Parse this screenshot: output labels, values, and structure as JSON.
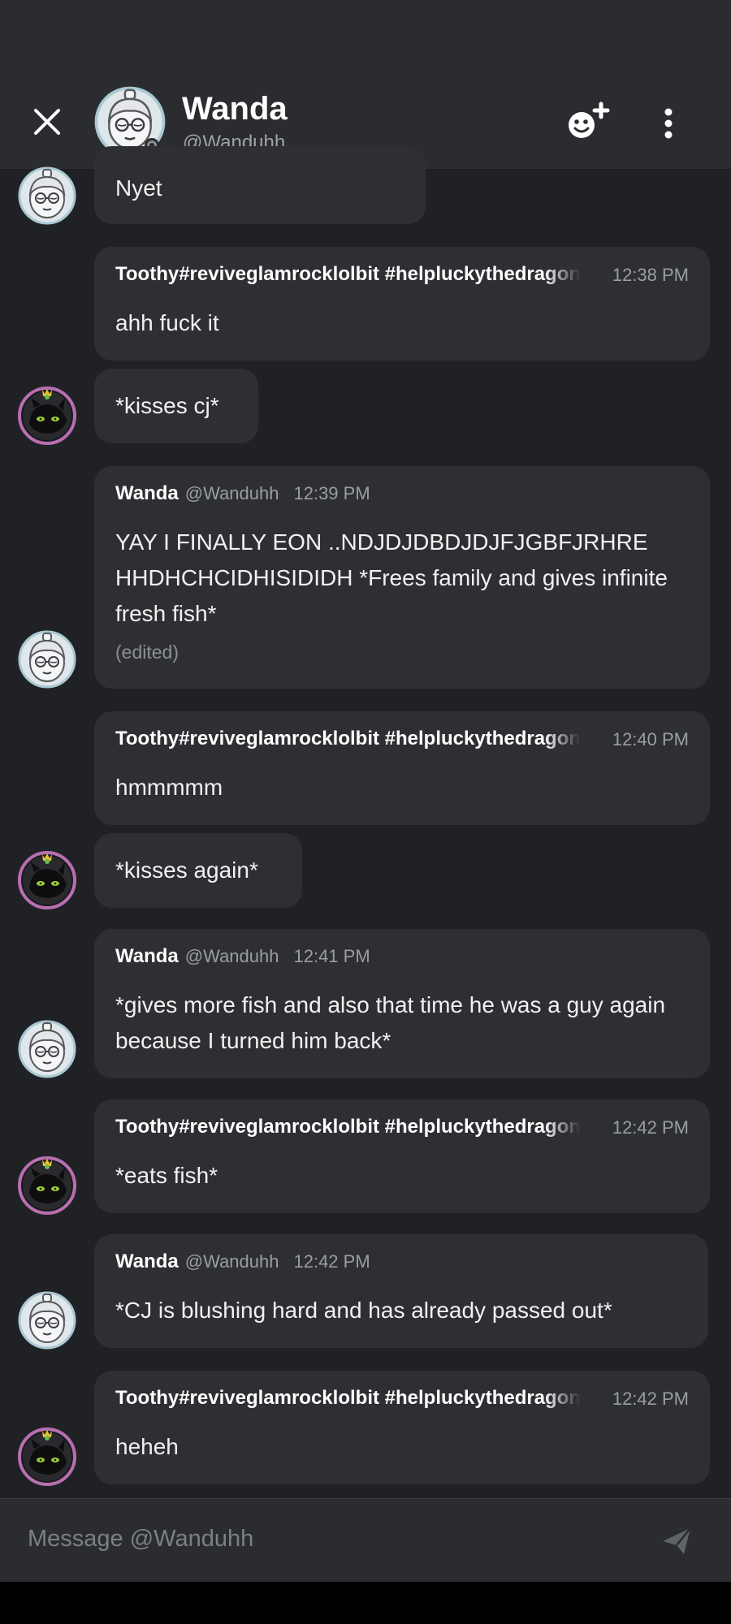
{
  "header": {
    "name": "Wanda",
    "handle": "@Wanduhh"
  },
  "messages": [
    {
      "avatar": "wanda",
      "text": "Nyet"
    },
    {
      "author": "Toothy#reviveglamrocklolbit #helpluckythedragon",
      "time": "12:38 PM",
      "text": "ahh fuck it"
    },
    {
      "avatar": "toothy",
      "text": "*kisses cj*"
    },
    {
      "author": "Wanda",
      "handle": "@Wanduhh",
      "time": "12:39 PM",
      "text": "YAY I FINALLY EON ..NDJDJDBDJDJFJGBFJRHRE HHDHCHCIDHISIDIDH *Frees family and gives infinite fresh fish*",
      "edited": "(edited)"
    },
    {
      "author": "Toothy#reviveglamrocklolbit #helpluckythedragon",
      "time": "12:40 PM",
      "text": "hmmmmm"
    },
    {
      "avatar": "toothy",
      "text": "*kisses again*"
    },
    {
      "author": "Wanda",
      "handle": "@Wanduhh",
      "time": "12:41 PM",
      "text": "*gives more fish and also that time he was a guy again because I turned him back*"
    },
    {
      "author": "Toothy#reviveglamrocklolbit #helpluckythedragon",
      "time": "12:42 PM",
      "text": "*eats fish*"
    },
    {
      "author": "Wanda",
      "handle": "@Wanduhh",
      "time": "12:42 PM",
      "text": "*CJ is blushing hard and has already passed out*"
    },
    {
      "author": "Toothy#reviveglamrocklolbit #helpluckythedragon",
      "time": "12:42 PM",
      "text": "heheh"
    }
  ],
  "composer": {
    "placeholder": "Message @Wanduhh"
  },
  "icons": {
    "close": "close-icon",
    "add_friend": "add-friend-icon",
    "more": "more-vertical-icon",
    "send": "send-icon"
  },
  "colors": {
    "background": "#202124",
    "header": "#2b2c2f",
    "bubble": "#2e2f33",
    "muted_text": "#9a9da3"
  }
}
